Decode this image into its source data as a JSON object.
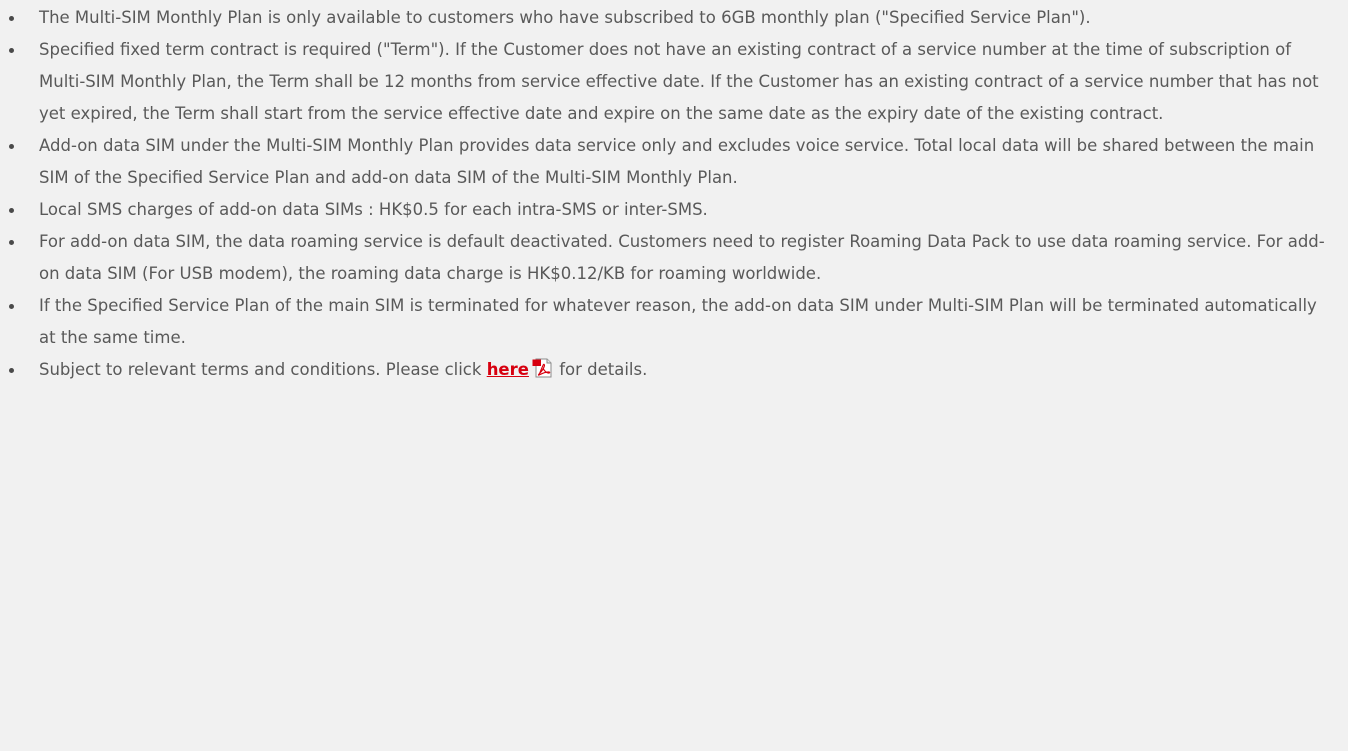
{
  "terms": {
    "items": [
      "The Multi-SIM Monthly Plan is only available to customers who have subscribed to 6GB monthly plan (\"Specified Service Plan\").",
      "Specified fixed term contract is required (\"Term\"). If the Customer does not have an existing contract of a service number at the time of subscription of Multi-SIM Monthly Plan, the Term shall be 12 months from service effective date. If the Customer has an existing contract of a service number that has not yet expired, the Term shall start from the service effective date and expire on the same date as the expiry date of the existing contract.",
      "Add-on data SIM under the Multi-SIM Monthly Plan provides data service only and excludes voice service. Total local data will be shared between the main SIM of the Specified Service Plan and add-on data SIM of the Multi-SIM Monthly Plan.",
      "Local SMS charges of add-on data SIMs : HK$0.5 for each intra-SMS or inter-SMS.",
      "For add-on data SIM, the data roaming service is default deactivated. Customers need to register Roaming Data Pack to use data roaming service. For add-on data SIM (For USB modem), the roaming data charge is HK$0.12/KB for roaming worldwide.",
      "If the Specified Service Plan of the main SIM is terminated for whatever reason, the add-on data SIM under Multi-SIM Plan will be terminated automatically at the same time."
    ],
    "last_item": {
      "prefix": "Subject to relevant terms and conditions. Please click ",
      "link_label": "here",
      "link_icon": "pdf-icon",
      "suffix": " for details."
    }
  },
  "colors": {
    "background": "#f1f1f1",
    "text": "#595959",
    "link": "#d7000f"
  }
}
